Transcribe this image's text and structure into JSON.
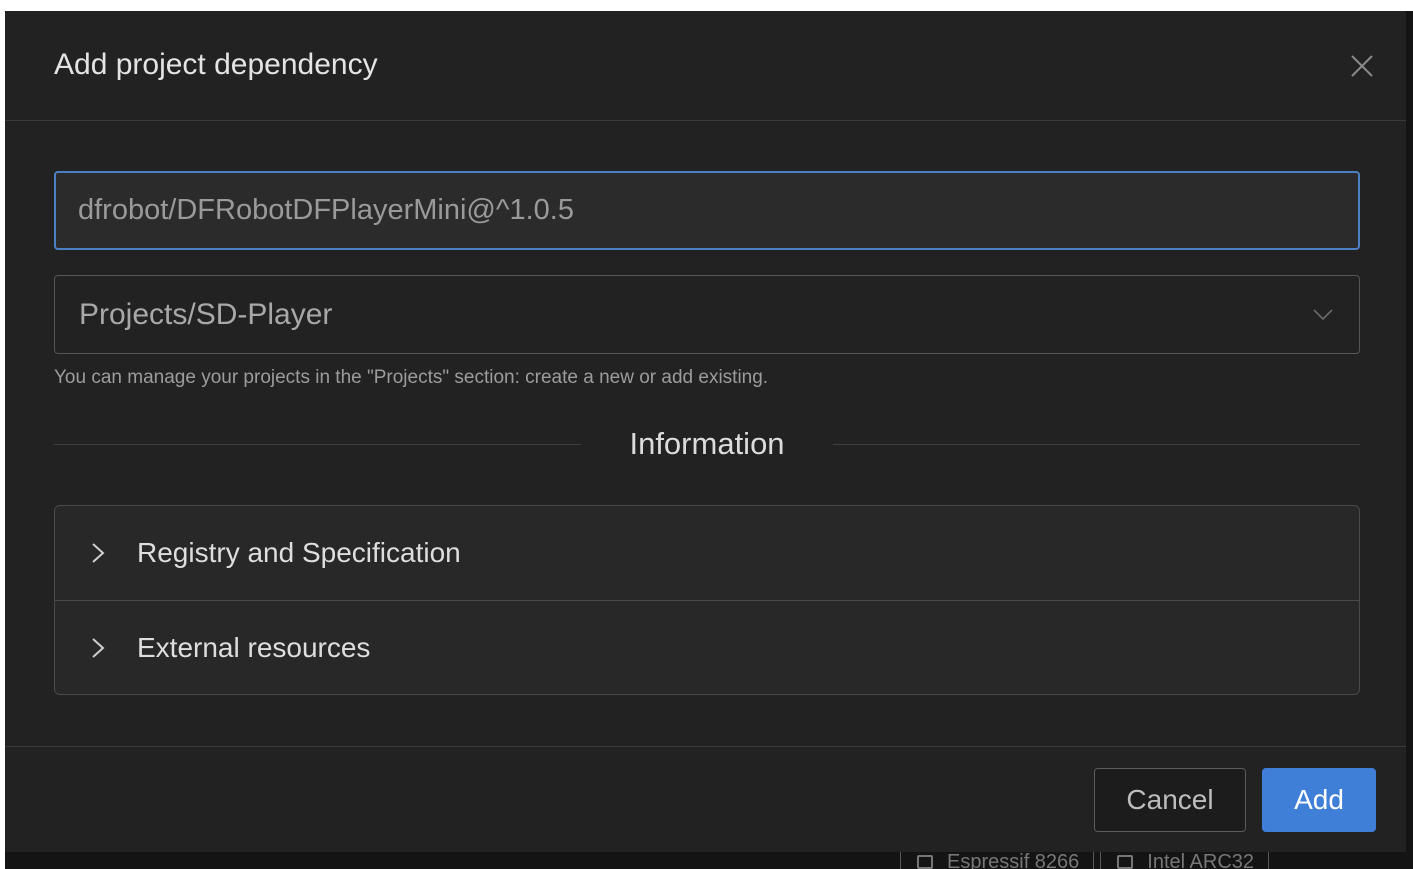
{
  "dialog": {
    "title": "Add project dependency",
    "close_icon": "close-icon"
  },
  "form": {
    "package_value": "dfrobot/DFRobotDFPlayerMini@^1.0.5",
    "project_value": "Projects/SD-Player",
    "help_text": "You can manage your projects in the \"Projects\" section: create a new or add existing."
  },
  "section": {
    "title": "Information",
    "items": [
      {
        "label": "Registry and Specification",
        "icon": "chevron-right-icon"
      },
      {
        "label": "External resources",
        "icon": "chevron-right-icon"
      }
    ]
  },
  "footer": {
    "cancel_label": "Cancel",
    "add_label": "Add"
  },
  "background": {
    "tabs": [
      {
        "label": "Espressif 8266",
        "icon": "chip-icon"
      },
      {
        "label": "Intel ARC32",
        "icon": "chip-icon"
      }
    ]
  },
  "colors": {
    "accent": "#3f7fd8",
    "input_focus_border": "#4d7fc4",
    "dialog_bg": "#222222"
  }
}
